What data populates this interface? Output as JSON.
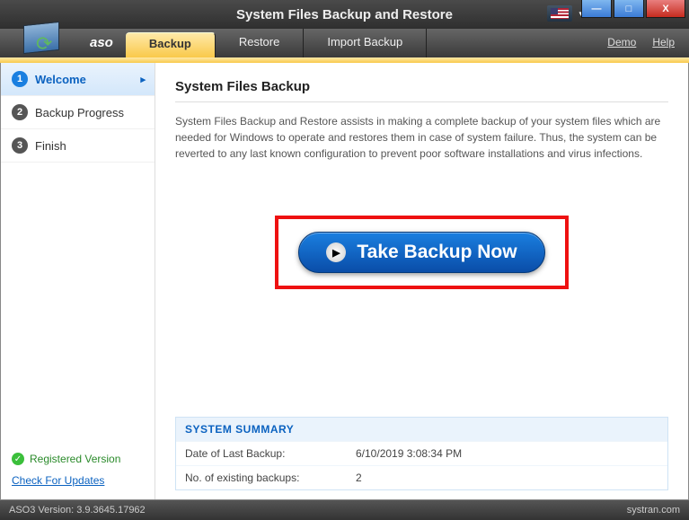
{
  "window": {
    "title": "System Files Backup and Restore"
  },
  "brand": "aso",
  "tabs": {
    "backup": "Backup",
    "restore": "Restore",
    "import": "Import Backup"
  },
  "menu": {
    "demo": "Demo",
    "help": "Help"
  },
  "steps": {
    "welcome": {
      "num": "1",
      "label": "Welcome"
    },
    "progress": {
      "num": "2",
      "label": "Backup Progress"
    },
    "finish": {
      "num": "3",
      "label": "Finish"
    }
  },
  "sidebar": {
    "registered": "Registered Version",
    "updates": "Check For Updates"
  },
  "main": {
    "heading": "System Files Backup",
    "description": "System Files Backup and Restore assists in making a complete backup of your system files which are needed for Windows to operate and restores them in case of system failure. Thus, the system can be reverted to any last known configuration to prevent poor software installations and virus infections.",
    "cta": "Take Backup Now"
  },
  "summary": {
    "title": "SYSTEM SUMMARY",
    "rows": [
      {
        "k": "Date of Last Backup:",
        "v": "6/10/2019 3:08:34 PM"
      },
      {
        "k": "No. of existing backups:",
        "v": "2"
      }
    ]
  },
  "status": {
    "version": "ASO3 Version: 3.9.3645.17962",
    "brandmark": "systran.com"
  }
}
